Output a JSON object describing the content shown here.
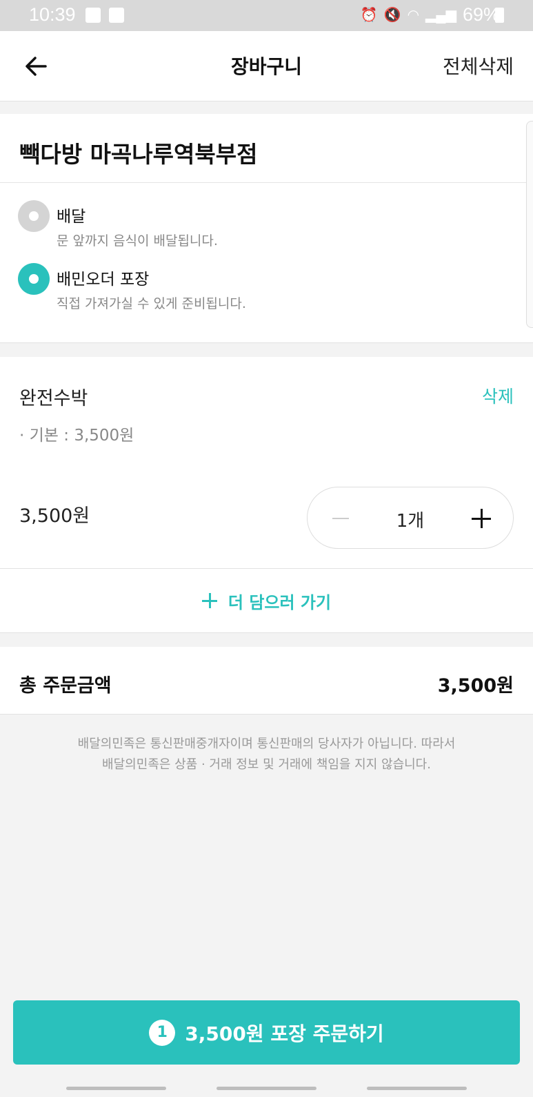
{
  "status_bar": {
    "time": "10:39",
    "battery": "69%",
    "icons_left": [
      "image-icon",
      "check-icon"
    ],
    "icons_right": [
      "alarm-icon",
      "mute-icon",
      "volte-icon",
      "wifi-icon",
      "signal-icon",
      "battery-icon"
    ]
  },
  "header": {
    "title": "장바구니",
    "clear_all": "전체삭제"
  },
  "store": {
    "name": "빽다방 마곡나루역북부점",
    "options": [
      {
        "label": "배달",
        "desc": "문 앞까지 음식이 배달됩니다.",
        "selected": false
      },
      {
        "label": "배민오더 포장",
        "desc": "직접 가져가실 수 있게 준비됩니다.",
        "selected": true
      }
    ]
  },
  "item": {
    "name": "완전수박",
    "delete": "삭제",
    "option": "· 기본 : 3,500원",
    "price": "3,500원",
    "quantity": "1개"
  },
  "add_more": "더 담으러 가기",
  "total": {
    "label": "총 주문금액",
    "value": "3,500원"
  },
  "notice": {
    "line1": "배달의민족은 통신판매중개자이며 통신판매의 당사자가 아닙니다. 따라서",
    "line2": "배달의민족은 상품 · 거래 정보 및 거래에 책임을 지지 않습니다."
  },
  "order_button": {
    "count": "1",
    "label": "3,500원 포장 주문하기"
  },
  "colors": {
    "accent": "#2ac1bc",
    "status_bar": "#d9d9d9"
  }
}
